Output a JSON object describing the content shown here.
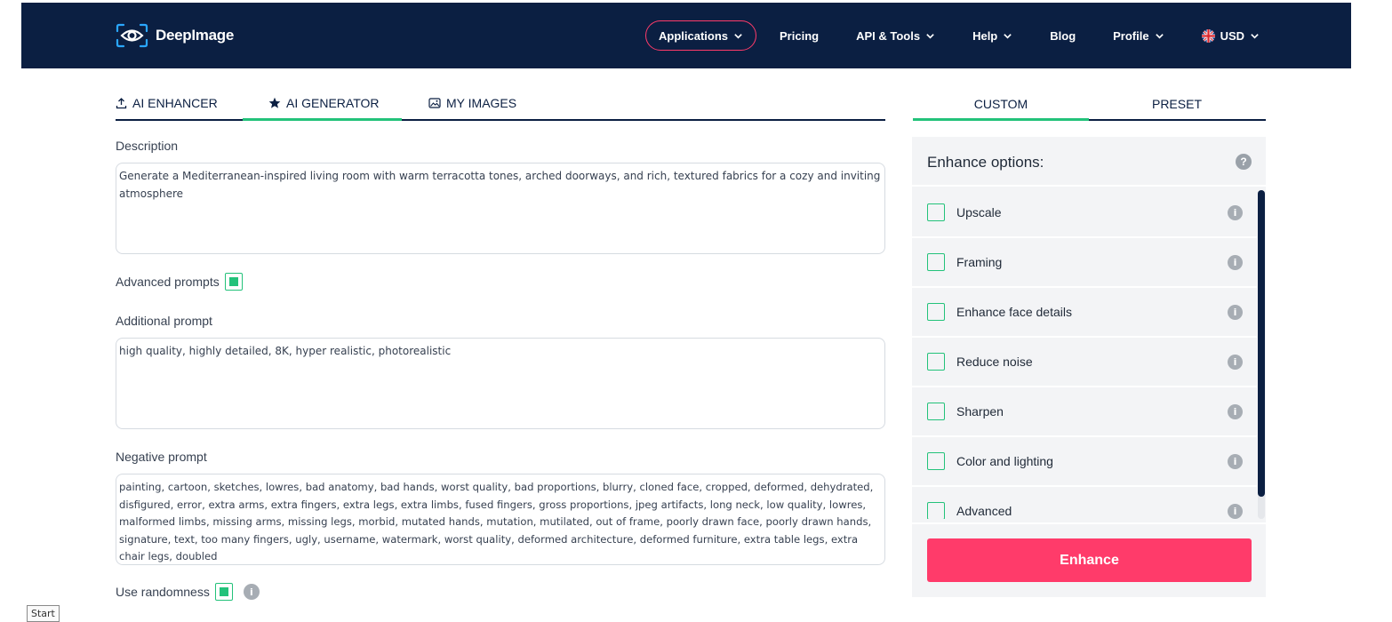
{
  "header": {
    "logo_text": "DeepImage",
    "nav": {
      "applications": "Applications",
      "pricing": "Pricing",
      "api_tools": "API & Tools",
      "help": "Help",
      "blog": "Blog",
      "profile": "Profile",
      "currency": "USD"
    }
  },
  "tabs": {
    "enhancer": "AI ENHANCER",
    "generator": "AI GENERATOR",
    "my_images": "MY IMAGES",
    "active": "AI GENERATOR"
  },
  "right_tabs": {
    "custom": "CUSTOM",
    "preset": "PRESET",
    "active": "CUSTOM"
  },
  "form": {
    "description_label": "Description",
    "description_value": "Generate a Mediterranean-inspired living room with warm terracotta tones, arched doorways, and rich, textured fabrics for a cozy and inviting atmosphere",
    "advanced_prompts_label": "Advanced prompts",
    "advanced_prompts_checked": true,
    "additional_prompt_label": "Additional prompt",
    "additional_prompt_value": "high quality, highly detailed, 8K, hyper realistic, photorealistic",
    "negative_prompt_label": "Negative prompt",
    "negative_prompt_value": "painting, cartoon, sketches, lowres, bad anatomy, bad hands, worst quality, bad proportions, blurry, cloned face, cropped, deformed, dehydrated, disfigured, error, extra arms, extra fingers, extra legs, extra limbs, fused fingers, gross proportions, jpeg artifacts, long neck, low quality, lowres, malformed limbs, missing arms, missing legs, morbid, mutated hands, mutation, mutilated, out of frame, poorly drawn face, poorly drawn hands, signature, text, too many fingers, ugly, username, watermark, worst quality, deformed architecture, deformed furniture, extra table legs, extra chair legs, doubled",
    "use_randomness_label": "Use randomness",
    "use_randomness_checked": true
  },
  "enhance_panel": {
    "title": "Enhance options:",
    "help_icon": "?",
    "info_icon": "i",
    "options": [
      {
        "label": "Upscale",
        "checked": false
      },
      {
        "label": "Framing",
        "checked": false
      },
      {
        "label": "Enhance face details",
        "checked": false
      },
      {
        "label": "Reduce noise",
        "checked": false
      },
      {
        "label": "Sharpen",
        "checked": false
      },
      {
        "label": "Color and lighting",
        "checked": false
      },
      {
        "label": "Advanced",
        "checked": false
      }
    ],
    "enhance_button": "Enhance"
  },
  "taskbar": {
    "start_label": "Start"
  },
  "colors": {
    "header_bg": "#0b1f42",
    "accent_pink": "#ff3b6a",
    "accent_green": "#23c27a"
  }
}
